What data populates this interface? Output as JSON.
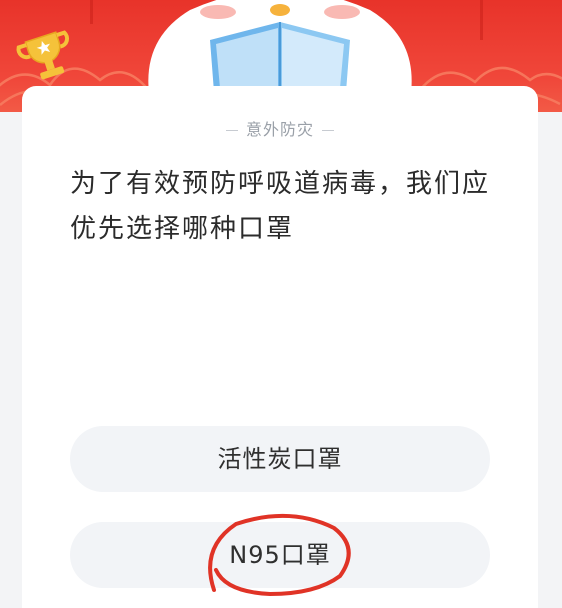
{
  "quiz": {
    "category": "意外防灾",
    "question_line1": "为了有效预防呼吸道病毒，我们应",
    "question_line2": "优先选择哪种口罩",
    "options": [
      {
        "label": "活性炭口罩"
      },
      {
        "label": "N95口罩",
        "annotated": true
      }
    ]
  },
  "colors": {
    "banner": "#e8332a",
    "annotation": "#e03326",
    "option_bg": "#f2f4f7",
    "category_text": "#9aa0a8"
  },
  "icons": [
    "trophy-icon",
    "mascot-reading-book",
    "hand-drawn-circle"
  ]
}
